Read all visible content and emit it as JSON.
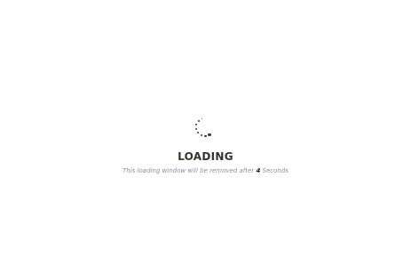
{
  "loader": {
    "title": "LOADING",
    "message_prefix": "This loading window will be removed after",
    "countdown": "4",
    "message_suffix": "Seconds"
  },
  "colors": {
    "background": "#ffffff",
    "spinner_dot": "#3a3a3a",
    "title": "#333333",
    "message": "#8a8ea2",
    "countdown": "#222222"
  }
}
